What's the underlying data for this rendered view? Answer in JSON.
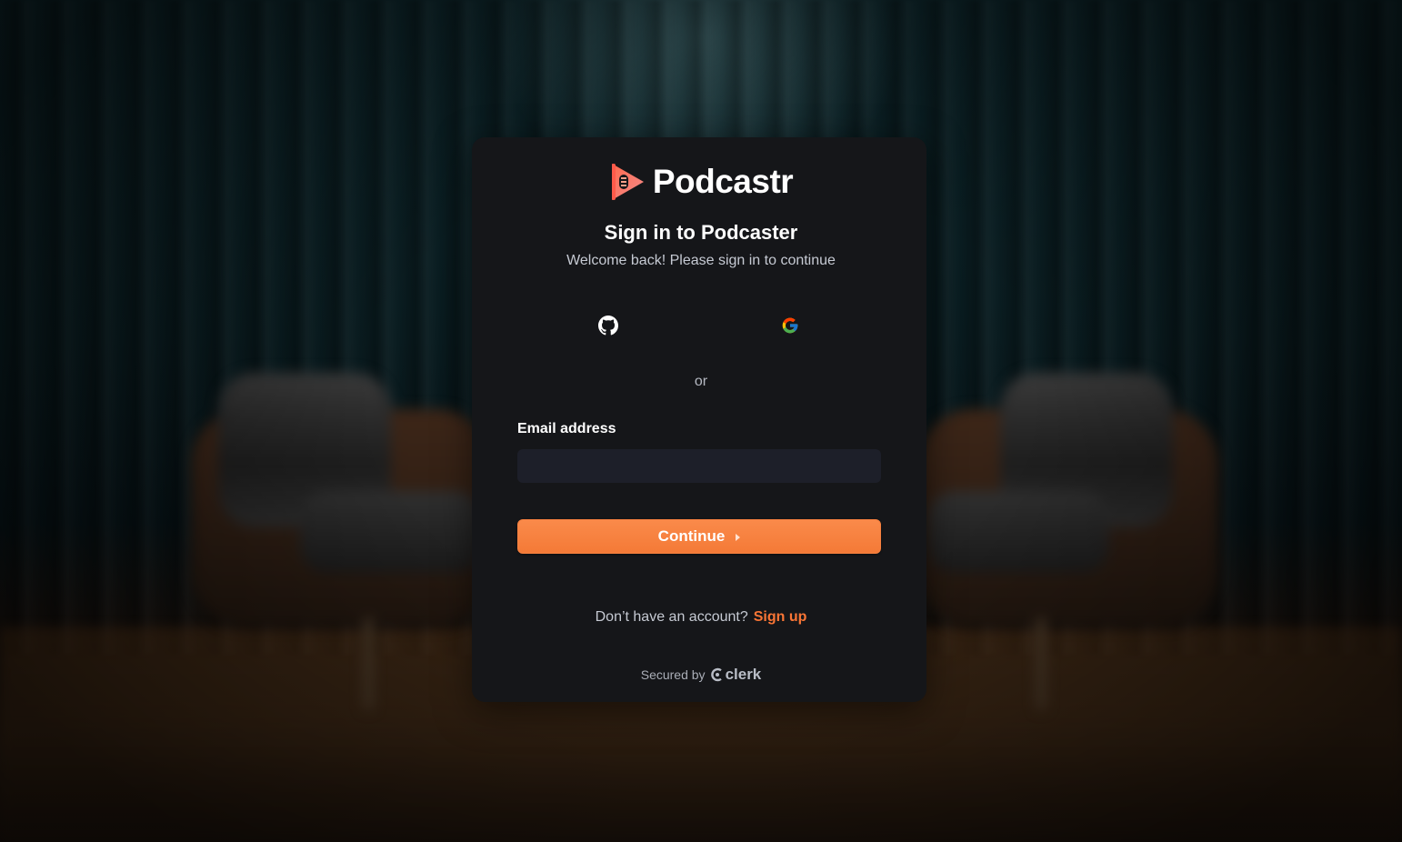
{
  "brand": {
    "name": "Podcastr",
    "accent_color": "#f97535"
  },
  "signin": {
    "title": "Sign in to Podcaster",
    "subtitle": "Welcome back! Please sign in to continue",
    "social": [
      {
        "provider": "github",
        "icon": "github-icon"
      },
      {
        "provider": "google",
        "icon": "google-icon"
      }
    ],
    "divider_text": "or",
    "email_label": "Email address",
    "email_value": "",
    "email_placeholder": "",
    "continue_label": "Continue",
    "no_account_text": "Don’t have an account?",
    "signup_label": "Sign up",
    "secured_by_text": "Secured by",
    "secured_provider": "clerk"
  }
}
